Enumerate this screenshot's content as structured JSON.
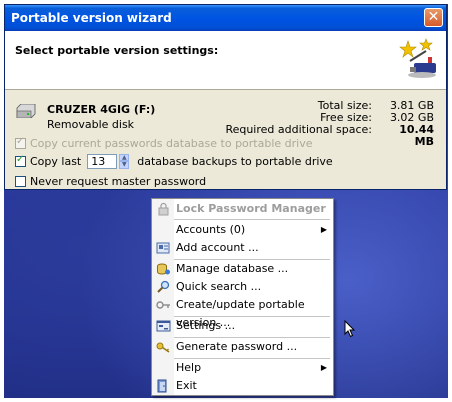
{
  "wizard": {
    "title": "Portable version wizard",
    "close_glyph": "✕",
    "header": "Select portable version settings:",
    "header_icon": "magic-wand-icon",
    "drive": {
      "name": "CRUZER 4GIG (F:)",
      "type": "Removable disk",
      "icon": "drive-icon"
    },
    "sizes": [
      {
        "label": "Total size:",
        "value": "3.81 GB"
      },
      {
        "label": "Free size:",
        "value": "3.02 GB"
      },
      {
        "label": "Required additional space:",
        "value": "10.44 MB"
      }
    ],
    "options": {
      "copy_current": {
        "label": "Copy current passwords database to portable drive",
        "checked": true,
        "disabled": true
      },
      "copy_last_prefix": "Copy last",
      "copy_last_value": "13",
      "copy_last_suffix": "database backups to portable drive",
      "copy_last_checked": true,
      "never_request": {
        "label": "Never request master password",
        "checked": false
      }
    }
  },
  "menu": {
    "title": "Lock Password Manager",
    "items": [
      {
        "label": "Accounts (0)",
        "icon": "none",
        "submenu": true
      },
      {
        "label": "Add account ...",
        "icon": "add-account-icon"
      },
      {
        "label": "Manage database ...",
        "icon": "database-icon"
      },
      {
        "label": "Quick search ...",
        "icon": "search-icon"
      },
      {
        "label": "Create/update portable version ...",
        "icon": "key-icon"
      },
      {
        "label": "Settings ...",
        "icon": "settings-icon"
      },
      {
        "label": "Generate password ...",
        "icon": "generate-key-icon"
      },
      {
        "label": "Help",
        "icon": "none",
        "submenu": true
      },
      {
        "label": "Exit",
        "icon": "exit-icon"
      }
    ],
    "submenu_arrow": "▶"
  },
  "colors": {
    "titlebar": "#0054e3",
    "dialog_bg": "#ece9d8",
    "desktop": "#27379c"
  }
}
